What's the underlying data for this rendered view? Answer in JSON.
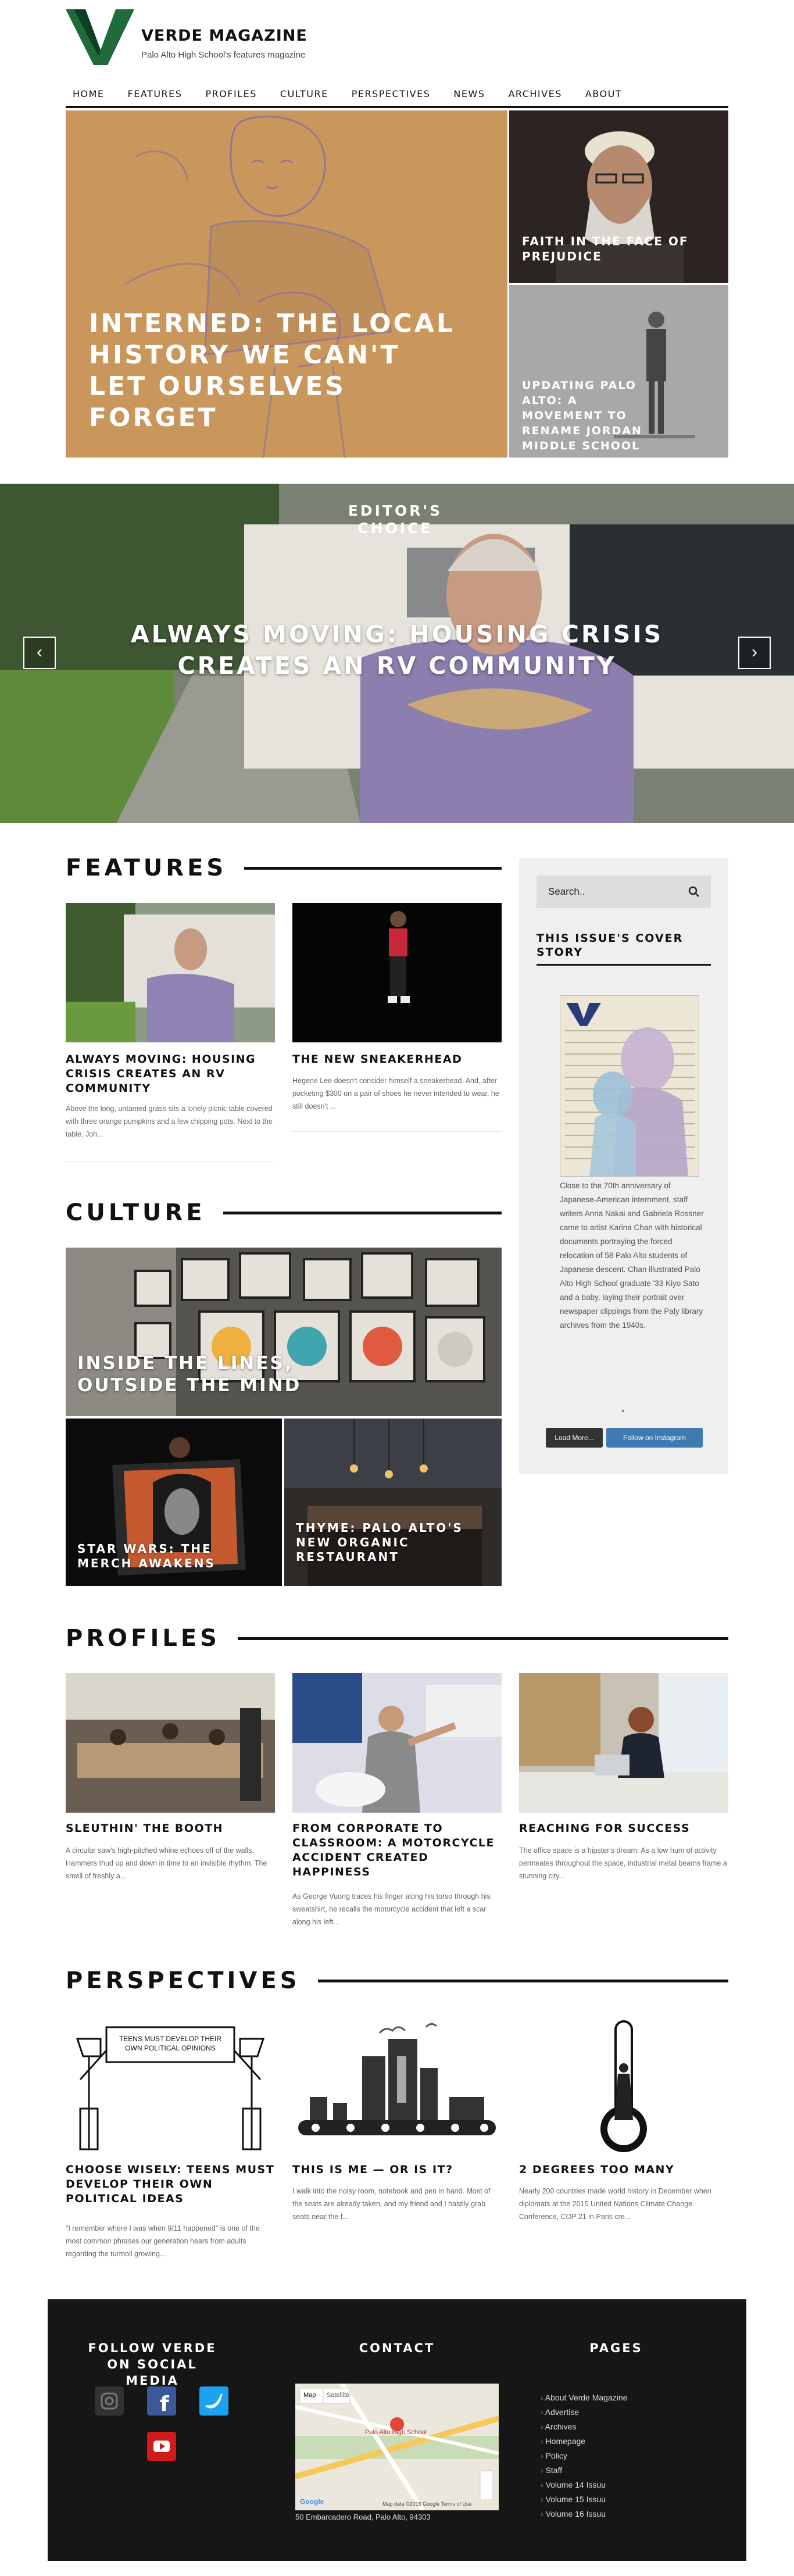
{
  "brand": {
    "title": "VERDE MAGAZINE",
    "subtitle": "Palo Alto High School's features magazine",
    "color": "#1f6b3a"
  },
  "nav": [
    "HOME",
    "FEATURES",
    "PROFILES",
    "CULTURE",
    "PERSPECTIVES",
    "NEWS",
    "ARCHIVES",
    "ABOUT"
  ],
  "hero": {
    "main_title": "INTERNED: THE LOCAL HISTORY WE CAN'T LET OURSELVES FORGET",
    "side1_title": "FAITH IN THE FACE OF PREJUDICE",
    "side2_title": "UPDATING PALO ALTO: A MOVEMENT TO RENAME JORDAN MIDDLE SCHOOL"
  },
  "editors_choice": {
    "tag": "EDITOR'S CHOICE",
    "title": "ALWAYS MOVING: HOUSING CRISIS CREATES AN RV COMMUNITY",
    "prev": "‹",
    "next": "›"
  },
  "features": {
    "heading": "FEATURES",
    "items": [
      {
        "title": "ALWAYS MOVING: HOUSING CRISIS CREATES AN RV COMMUNITY",
        "excerpt": "Above the long, untamed grass sits a lonely picnic table covered with three orange pumpkins and a few chipping pots.  Next to the table, Joh..."
      },
      {
        "title": "THE NEW SNEAKERHEAD",
        "excerpt": "Hegene Lee doesn't consider himself a sneakerhead. And, after pocketing $300 on a pair of shoes he never intended to wear, he still doesn't ..."
      }
    ]
  },
  "sidebar": {
    "search_placeholder": "Search..",
    "cover_heading": "THIS ISSUE'S COVER STORY",
    "cover_text": "Close to the 70th anniversary of Japanese-American internment, staff writers Anna Nakai and Gabriela Rossner came to artist Karina Chan with historical documents portraying the forced relocation of 58 Palo Alto students of Japanese descent. Chan illustrated Palo Alto High School graduate '33 Kiyo Sato and a baby, laying their portrait over newspaper clippings from the Paly library archives from the 1940s.",
    "ig_dots": "\"",
    "load_more": "Load More...",
    "follow": "Follow on Instagram"
  },
  "culture": {
    "heading": "CULTURE",
    "main_title": "INSIDE THE LINES, OUTSIDE THE MIND",
    "left_title": "STAR WARS: THE MERCH AWAKENS",
    "right_title": "THYME: PALO ALTO'S NEW ORGANIC RESTAURANT"
  },
  "profiles": {
    "heading": "PROFILES",
    "items": [
      {
        "title": "SLEUTHIN' THE BOOTH",
        "excerpt": "A circular saw's high-pitched whine echoes off of the walls. Hammers thud up and down in time to an invisible rhythm. The smell of freshly a..."
      },
      {
        "title": "FROM CORPORATE TO CLASSROOM: A MOTORCYCLE ACCIDENT CREATED HAPPINESS",
        "excerpt": "As George Vuong traces his finger along his torso through his sweatshirt, he recalls the motorcycle accident that left a scar along his left..."
      },
      {
        "title": "REACHING FOR SUCCESS",
        "excerpt": "The office space is a hipster's dream: As a low hum of activity permeates throughout the space, industrial metal beams frame a stunning city..."
      }
    ]
  },
  "perspectives": {
    "heading": "PERSPECTIVES",
    "cartoon_text": "TEENS MUST DEVELOP THEIR OWN POLITICAL OPINIONS",
    "items": [
      {
        "title": "CHOOSE WISELY: TEENS MUST DEVELOP THEIR OWN POLITICAL IDEAS",
        "excerpt": "\"I remember where I was when 9/11 happened\" is one of the most common phrases our generation hears from adults regarding the turmoil growing..."
      },
      {
        "title": "THIS IS ME — OR IS IT?",
        "excerpt": "I walk into the noisy room, notebook and pen in hand. Most of the seats are already taken, and my friend and I hastily grab seats near the f..."
      },
      {
        "title": "2 DEGREES TOO MANY",
        "excerpt": "Nearly 200 countries made world history in December when diplomats at the 2015 United Nations Climate Change Conference, COP 21 in Paris cre..."
      }
    ]
  },
  "footer": {
    "social_heading": "FOLLOW VERDE ON SOCIAL MEDIA",
    "contact_heading": "CONTACT",
    "pages_heading": "PAGES",
    "social": [
      "instagram-icon",
      "facebook-icon",
      "twitter-icon",
      "youtube-icon"
    ],
    "map_tabs": [
      "Map",
      "Satellite"
    ],
    "map_label": "Palo Alto High School",
    "map_credit": "Google",
    "map_footer": "Map data ©2016 Google  Terms of Use",
    "address": "50 Embarcadero Road, Palo Alto, 94303",
    "pages": [
      "About Verde Magazine",
      "Advertise",
      "Archives",
      "Homepage",
      "Policy",
      "Staff",
      "Volume 14 Issuu",
      "Volume 15 Issuu",
      "Volume 16 Issuu"
    ]
  }
}
